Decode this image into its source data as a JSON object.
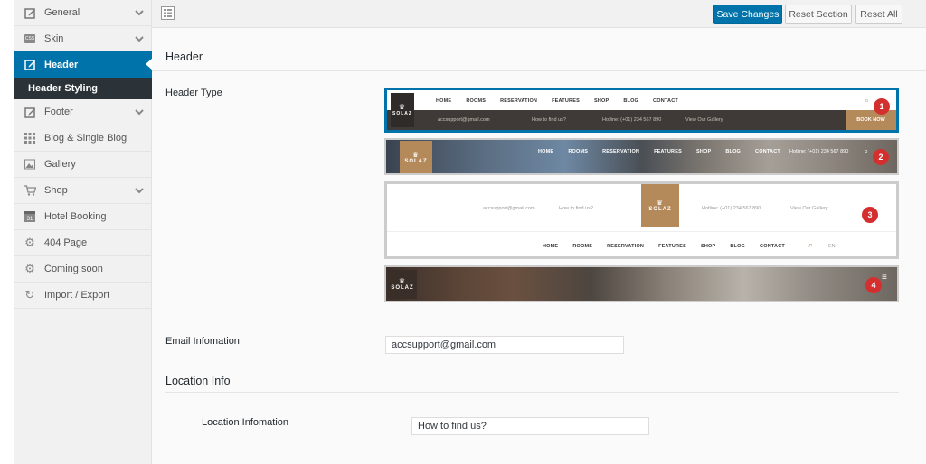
{
  "sidebar": {
    "items": [
      {
        "label": "General",
        "icon": "edit-icon",
        "has_children": true
      },
      {
        "label": "Skin",
        "icon": "css-icon",
        "has_children": true
      },
      {
        "label": "Header",
        "icon": "edit-icon",
        "has_children": false,
        "active": true
      },
      {
        "label": "Footer",
        "icon": "edit-icon",
        "has_children": true
      },
      {
        "label": "Blog & Single Blog",
        "icon": "grid-icon",
        "has_children": false
      },
      {
        "label": "Gallery",
        "icon": "image-icon",
        "has_children": false
      },
      {
        "label": "Shop",
        "icon": "cart-icon",
        "has_children": true
      },
      {
        "label": "Hotel Booking",
        "icon": "calendar-icon",
        "has_children": false
      },
      {
        "label": "404 Page",
        "icon": "gear-icon",
        "has_children": false
      },
      {
        "label": "Coming soon",
        "icon": "gear-icon",
        "has_children": false
      },
      {
        "label": "Import / Export",
        "icon": "refresh-icon",
        "has_children": false
      }
    ],
    "sub_item": "Header Styling",
    "calendar_badge": "31",
    "css_badge": "CSS"
  },
  "toolbar": {
    "save_label": "Save Changes",
    "reset_section_label": "Reset Section",
    "reset_all_label": "Reset All"
  },
  "main": {
    "header_title": "Header",
    "header_type_label": "Header Type",
    "email_label": "Email Infomation",
    "email_value": "accsupport@gmail.com",
    "location_section_title": "Location Info",
    "location_label": "Location Infomation",
    "location_value": "How to find us?"
  },
  "previews": {
    "logo_text": "SOLAZ",
    "crown": "♛",
    "nav": [
      "HOME",
      "ROOMS",
      "RESERVATION",
      "FEATURES",
      "SHOP",
      "BLOG",
      "CONTACT"
    ],
    "email": "accsupport@gmail.com",
    "find_us": "How to find us?",
    "hotline": "Hotline: (+01) 234 567 890",
    "gallery": "View Our Gallery",
    "book_now": "BOOK NOW",
    "lang": "EN",
    "badges": [
      "1",
      "2",
      "3",
      "4"
    ]
  },
  "colors": {
    "accent": "#0073aa",
    "gold": "#b58a5a",
    "badge": "#d32f2f"
  }
}
